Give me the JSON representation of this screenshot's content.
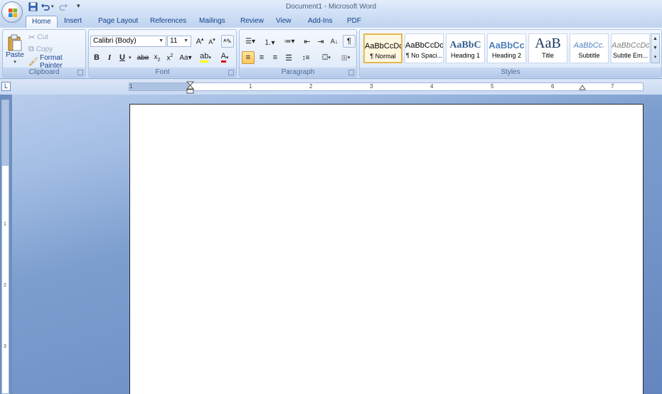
{
  "window": {
    "title": "Document1 - Microsoft Word"
  },
  "tabs": [
    "Home",
    "Insert",
    "Page Layout",
    "References",
    "Mailings",
    "Review",
    "View",
    "Add-Ins",
    "PDF"
  ],
  "clipboard": {
    "paste": "Paste",
    "cut": "Cut",
    "copy": "Copy",
    "format_painter": "Format Painter",
    "label": "Clipboard"
  },
  "font": {
    "name": "Calibri (Body)",
    "size": "11",
    "label": "Font"
  },
  "paragraph": {
    "label": "Paragraph"
  },
  "styles": {
    "label": "Styles",
    "items": [
      {
        "sample": "AaBbCcDc",
        "name": "¶ Normal"
      },
      {
        "sample": "AaBbCcDc",
        "name": "¶ No Spaci..."
      },
      {
        "sample": "AaBbC",
        "name": "Heading 1"
      },
      {
        "sample": "AaBbCc",
        "name": "Heading 2"
      },
      {
        "sample": "AaB",
        "name": "Title"
      },
      {
        "sample": "AaBbCc.",
        "name": "Subtitle"
      },
      {
        "sample": "AaBbCcDc",
        "name": "Subtle Em..."
      }
    ]
  },
  "ruler": {
    "numbers": [
      "1",
      "1",
      "2",
      "3",
      "4",
      "5",
      "6",
      "7"
    ]
  },
  "vruler": {
    "numbers": [
      "1",
      "2",
      "3"
    ]
  },
  "colors": {
    "accent": "#15428b",
    "ribbon_border": "#8ba8d0",
    "selection": "#ffc75a"
  }
}
